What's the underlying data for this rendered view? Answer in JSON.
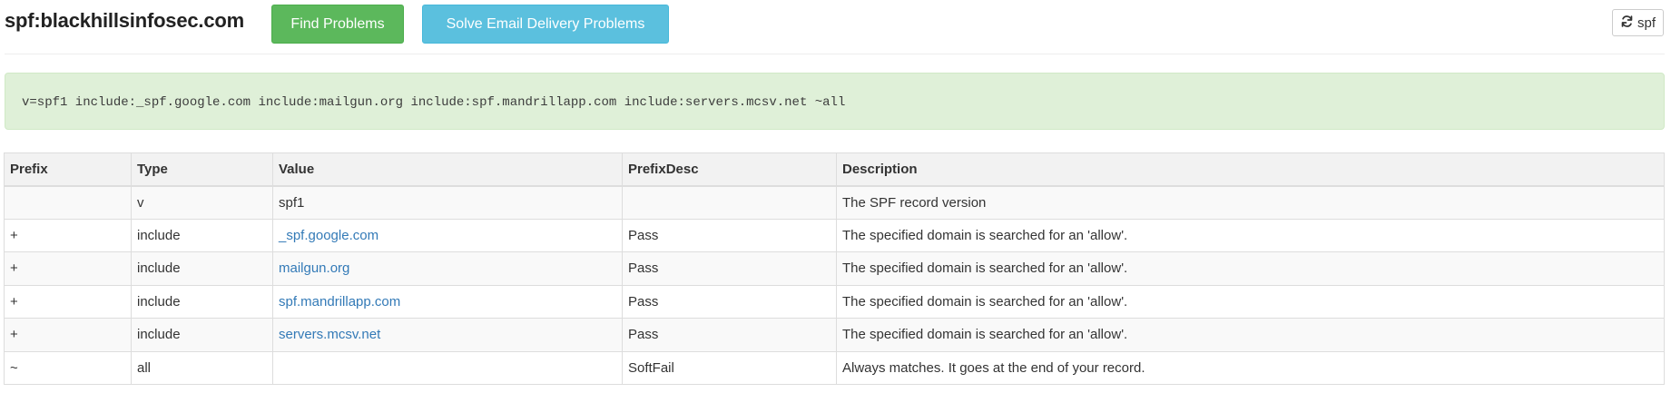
{
  "header": {
    "domain": "spf:blackhillsinfosec.com",
    "find_label": "Find Problems",
    "solve_label": "Solve Email Delivery Problems",
    "refresh_label": "spf",
    "refresh_icon": "refresh-icon"
  },
  "record": {
    "text": "v=spf1 include:_spf.google.com include:mailgun.org include:spf.mandrillapp.com include:servers.mcsv.net ~all"
  },
  "table": {
    "headers": {
      "prefix": "Prefix",
      "type": "Type",
      "value": "Value",
      "prefixdesc": "PrefixDesc",
      "description": "Description"
    },
    "rows": [
      {
        "prefix": "",
        "type": "v",
        "value": "spf1",
        "prefixdesc": "",
        "description": "The SPF record version"
      },
      {
        "prefix": "+",
        "type": "include",
        "value": "_spf.google.com",
        "prefixdesc": "Pass",
        "description": "The specified domain is searched for an 'allow'."
      },
      {
        "prefix": "+",
        "type": "include",
        "value": "mailgun.org",
        "prefixdesc": "Pass",
        "description": "The specified domain is searched for an 'allow'."
      },
      {
        "prefix": "+",
        "type": "include",
        "value": "spf.mandrillapp.com",
        "prefixdesc": "Pass",
        "description": "The specified domain is searched for an 'allow'."
      },
      {
        "prefix": "+",
        "type": "include",
        "value": "servers.mcsv.net",
        "prefixdesc": "Pass",
        "description": "The specified domain is searched for an 'allow'."
      },
      {
        "prefix": "~",
        "type": "all",
        "value": "",
        "prefixdesc": "SoftFail",
        "description": "Always matches. It goes at the end of your record."
      }
    ]
  },
  "colors": {
    "success": "#5cb85c",
    "info": "#5bc0de",
    "link": "#337ab7",
    "record_bg": "#dff0d8"
  }
}
